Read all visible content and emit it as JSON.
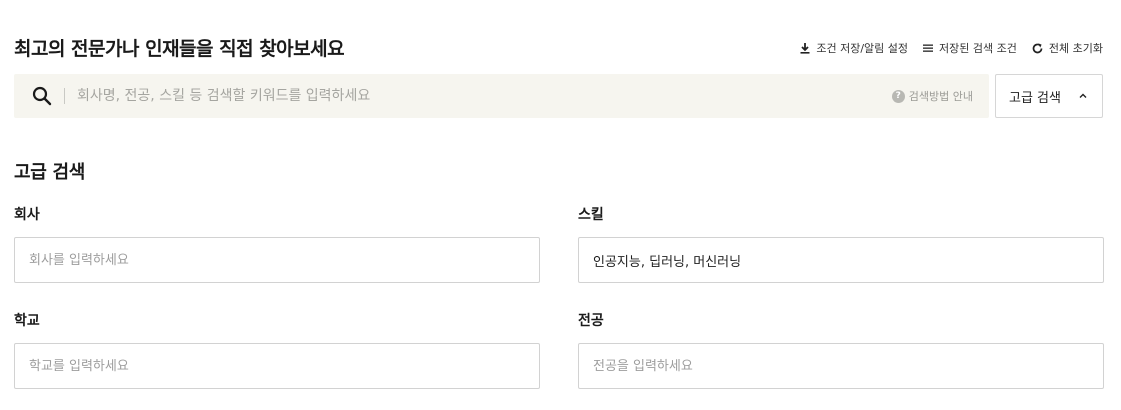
{
  "header": {
    "title": "최고의 전문가나 인재들을 직접 찾아보세요",
    "actions": [
      {
        "label": "조건 저장/알림 설정",
        "icon": "download-icon"
      },
      {
        "label": "저장된 검색 조건",
        "icon": "list-icon"
      },
      {
        "label": "전체 초기화",
        "icon": "refresh-icon"
      }
    ]
  },
  "search": {
    "placeholder": "회사명, 전공, 스킬 등 검색할 키워드를 입력하세요",
    "value": "",
    "help_label": "검색방법 안내",
    "help_icon_glyph": "?",
    "advanced_label": "고급 검색",
    "advanced_chevron": "⌃"
  },
  "advanced": {
    "title": "고급 검색",
    "company": {
      "label": "회사",
      "placeholder": "회사를 입력하세요",
      "value": ""
    },
    "skill": {
      "label": "스킬",
      "placeholder": "",
      "value": "인공지능, 딥러닝, 머신러닝"
    },
    "school": {
      "label": "학교",
      "placeholder": "학교를 입력하세요",
      "value": ""
    },
    "major": {
      "label": "전공",
      "placeholder": "전공을 입력하세요",
      "value": ""
    }
  },
  "colors": {
    "search_bg": "#f6f5ef",
    "border": "#d2d2d2",
    "placeholder": "#9d9d9d"
  }
}
